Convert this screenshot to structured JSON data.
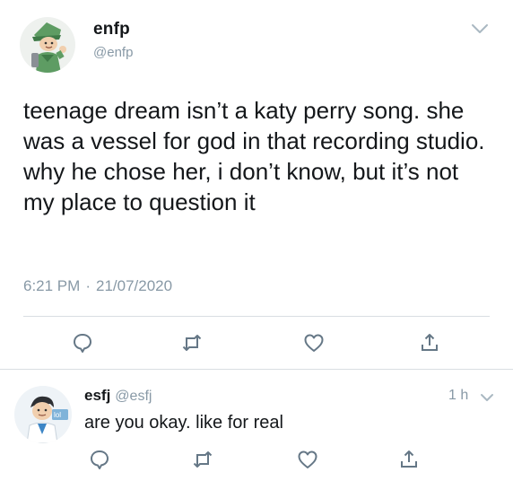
{
  "main_tweet": {
    "display_name": "enfp",
    "handle": "@enfp",
    "text": "teenage dream isn’t a katy perry song. she was a vessel for god in that recording studio. why he chose her, i don’t know, but it’s not my place to question it",
    "time": "6:21 PM",
    "separator": "·",
    "date": "21/07/2020",
    "avatar_icon": "campaigner-character-avatar",
    "menu_icon": "chevron-down-icon",
    "actions": [
      "reply-icon",
      "retweet-icon",
      "like-icon",
      "share-icon"
    ]
  },
  "reply": {
    "display_name": "esfj",
    "handle": "@esfj",
    "relative_time": "1 h",
    "text": "are you okay. like for real",
    "avatar_icon": "consul-character-avatar",
    "menu_icon": "chevron-down-icon",
    "actions": [
      "reply-icon",
      "retweet-icon",
      "like-icon",
      "share-icon"
    ]
  },
  "colors": {
    "text": "#14171a",
    "secondary": "#8899a6",
    "divider": "#d9dee2",
    "icon": "#657786"
  }
}
